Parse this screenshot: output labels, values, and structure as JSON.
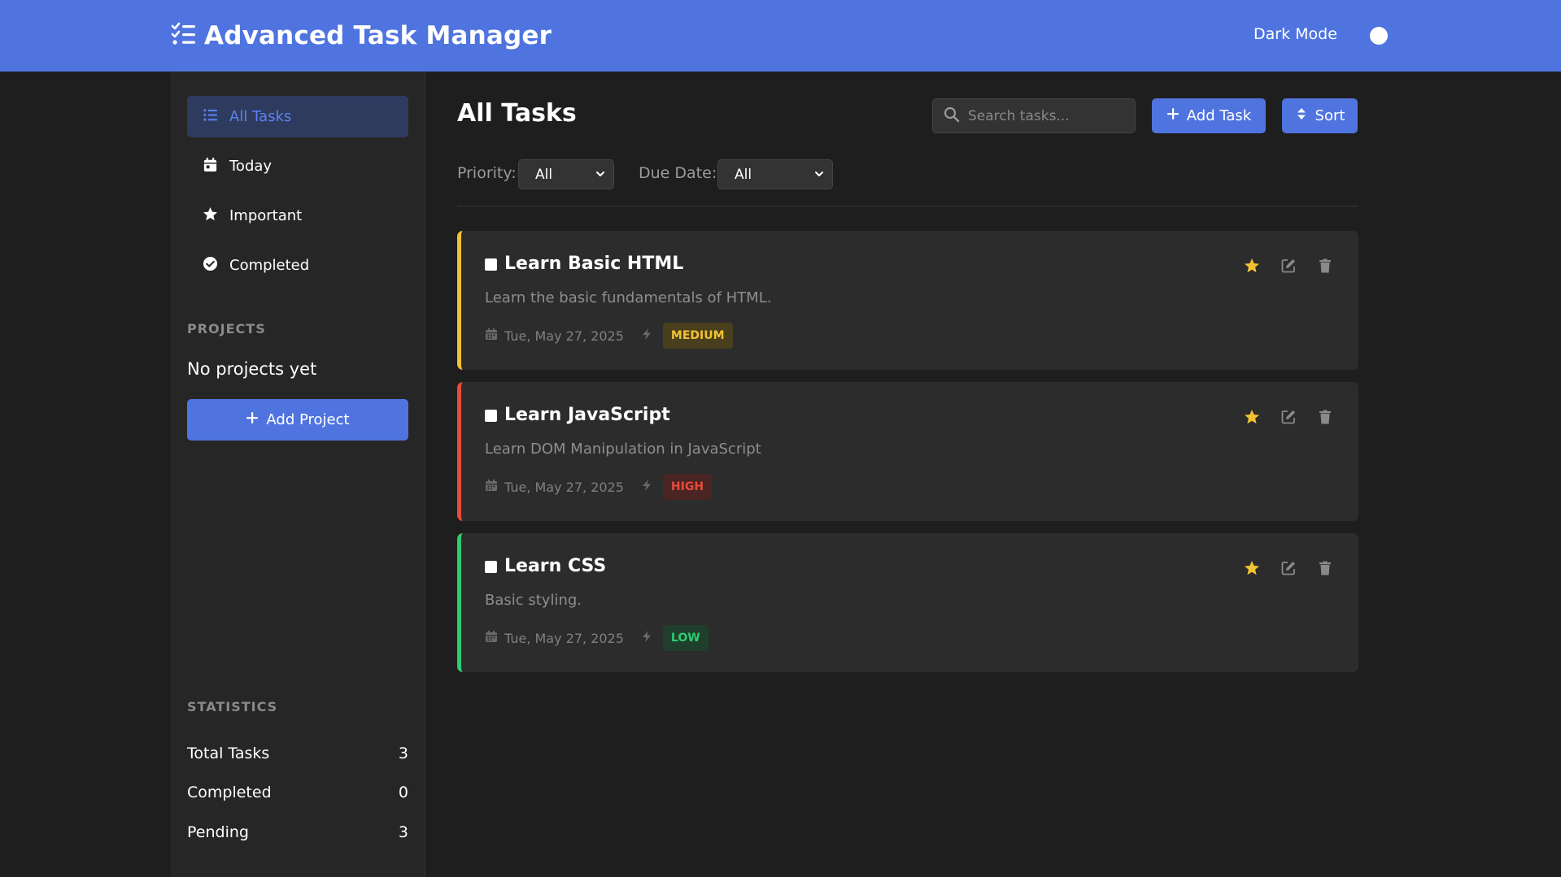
{
  "header": {
    "title": "Advanced Task Manager",
    "dark_mode_label": "Dark Mode"
  },
  "sidebar": {
    "nav": [
      {
        "label": "All Tasks",
        "icon": "list-icon",
        "active": true
      },
      {
        "label": "Today",
        "icon": "calendar-icon"
      },
      {
        "label": "Important",
        "icon": "star-icon"
      },
      {
        "label": "Completed",
        "icon": "check-circle-icon"
      }
    ],
    "projects_title": "PROJECTS",
    "no_projects": "No projects yet",
    "add_project_label": "Add Project",
    "statistics_title": "STATISTICS",
    "stats": [
      {
        "label": "Total Tasks",
        "value": "3"
      },
      {
        "label": "Completed",
        "value": "0"
      },
      {
        "label": "Pending",
        "value": "3"
      }
    ]
  },
  "main": {
    "title": "All Tasks",
    "search_placeholder": "Search tasks...",
    "add_task_label": "Add Task",
    "sort_label": "Sort",
    "priority_label": "Priority:",
    "priority_value": "All",
    "due_date_label": "Due Date:",
    "due_date_value": "All"
  },
  "tasks": [
    {
      "title": "Learn Basic HTML",
      "description": "Learn the basic fundamentals of HTML.",
      "date": "Tue, May 27, 2025",
      "priority": "MEDIUM",
      "color": "#f1c232",
      "badge_bg": "#4a3f1d",
      "important": true
    },
    {
      "title": "Learn JavaScript",
      "description": "Learn DOM Manipulation in JavaScript",
      "date": "Tue, May 27, 2025",
      "priority": "HIGH",
      "color": "#e74c3c",
      "badge_bg": "#4a2523",
      "important": true
    },
    {
      "title": "Learn CSS",
      "description": "Basic styling.",
      "date": "Tue, May 27, 2025",
      "priority": "LOW",
      "color": "#2ecc71",
      "badge_bg": "#1f3f2c",
      "important": true
    }
  ],
  "colors": {
    "accent": "#4f74e0",
    "background": "#1e1e1e",
    "sidebar": "#262626",
    "card": "#2c2c2c",
    "star": "#f1c232"
  }
}
